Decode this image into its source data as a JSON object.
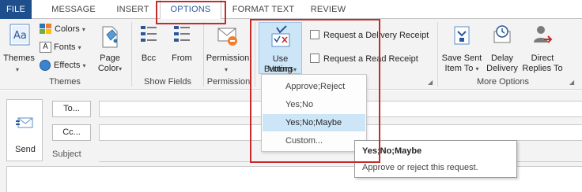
{
  "tabs": [
    "FILE",
    "MESSAGE",
    "INSERT",
    "OPTIONS",
    "FORMAT TEXT",
    "REVIEW"
  ],
  "active_tab": "OPTIONS",
  "colors": {
    "accent": "#2b579a",
    "file_tab": "#1e4e8c",
    "highlight": "#c42b2b",
    "hover": "#cde6f7"
  },
  "ribbon": {
    "themes_group": {
      "label": "Themes",
      "themes_button": "Themes",
      "colors": "Colors",
      "fonts": "Fonts",
      "effects": "Effects",
      "page_color_line1": "Page",
      "page_color_line2": "Color"
    },
    "show_fields_group": {
      "label": "Show Fields",
      "bcc": "Bcc",
      "from": "From"
    },
    "permission_group": {
      "label": "Permission",
      "button": "Permission"
    },
    "tracking_group": {
      "voting_line1": "Use Voting",
      "voting_line2": "Buttons",
      "delivery_receipt": "Request a Delivery Receipt",
      "read_receipt": "Request a Read Receipt"
    },
    "more_options_group": {
      "label": "More Options",
      "save_sent_line1": "Save Sent",
      "save_sent_line2": "Item To",
      "delay_line1": "Delay",
      "delay_line2": "Delivery",
      "direct_line1": "Direct",
      "direct_line2": "Replies To"
    }
  },
  "compose": {
    "send": "Send",
    "to": "To...",
    "cc": "Cc...",
    "subject": "Subject"
  },
  "voting_menu": {
    "items": [
      "Approve;Reject",
      "Yes;No",
      "Yes;No;Maybe",
      "Custom..."
    ],
    "hovered": "Yes;No;Maybe"
  },
  "tooltip": {
    "title": "Yes;No;Maybe",
    "description": "Approve or reject this request."
  }
}
